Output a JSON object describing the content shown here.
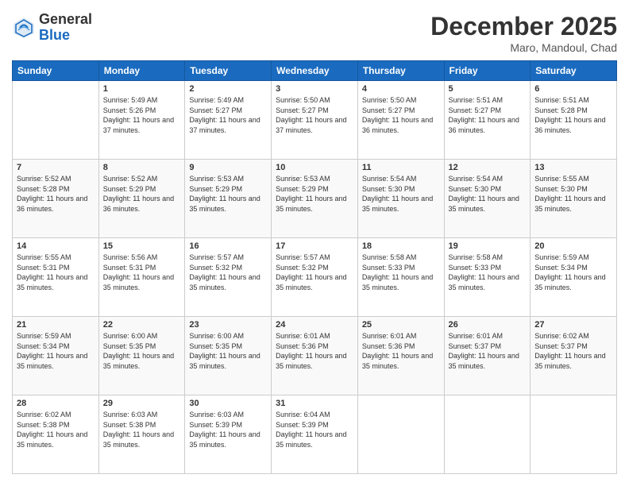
{
  "header": {
    "logo_general": "General",
    "logo_blue": "Blue",
    "title": "December 2025",
    "location": "Maro, Mandoul, Chad"
  },
  "weekdays": [
    "Sunday",
    "Monday",
    "Tuesday",
    "Wednesday",
    "Thursday",
    "Friday",
    "Saturday"
  ],
  "weeks": [
    [
      {
        "day": "",
        "sunrise": "",
        "sunset": "",
        "daylight": ""
      },
      {
        "day": "1",
        "sunrise": "Sunrise: 5:49 AM",
        "sunset": "Sunset: 5:26 PM",
        "daylight": "Daylight: 11 hours and 37 minutes."
      },
      {
        "day": "2",
        "sunrise": "Sunrise: 5:49 AM",
        "sunset": "Sunset: 5:27 PM",
        "daylight": "Daylight: 11 hours and 37 minutes."
      },
      {
        "day": "3",
        "sunrise": "Sunrise: 5:50 AM",
        "sunset": "Sunset: 5:27 PM",
        "daylight": "Daylight: 11 hours and 37 minutes."
      },
      {
        "day": "4",
        "sunrise": "Sunrise: 5:50 AM",
        "sunset": "Sunset: 5:27 PM",
        "daylight": "Daylight: 11 hours and 36 minutes."
      },
      {
        "day": "5",
        "sunrise": "Sunrise: 5:51 AM",
        "sunset": "Sunset: 5:27 PM",
        "daylight": "Daylight: 11 hours and 36 minutes."
      },
      {
        "day": "6",
        "sunrise": "Sunrise: 5:51 AM",
        "sunset": "Sunset: 5:28 PM",
        "daylight": "Daylight: 11 hours and 36 minutes."
      }
    ],
    [
      {
        "day": "7",
        "sunrise": "Sunrise: 5:52 AM",
        "sunset": "Sunset: 5:28 PM",
        "daylight": "Daylight: 11 hours and 36 minutes."
      },
      {
        "day": "8",
        "sunrise": "Sunrise: 5:52 AM",
        "sunset": "Sunset: 5:29 PM",
        "daylight": "Daylight: 11 hours and 36 minutes."
      },
      {
        "day": "9",
        "sunrise": "Sunrise: 5:53 AM",
        "sunset": "Sunset: 5:29 PM",
        "daylight": "Daylight: 11 hours and 35 minutes."
      },
      {
        "day": "10",
        "sunrise": "Sunrise: 5:53 AM",
        "sunset": "Sunset: 5:29 PM",
        "daylight": "Daylight: 11 hours and 35 minutes."
      },
      {
        "day": "11",
        "sunrise": "Sunrise: 5:54 AM",
        "sunset": "Sunset: 5:30 PM",
        "daylight": "Daylight: 11 hours and 35 minutes."
      },
      {
        "day": "12",
        "sunrise": "Sunrise: 5:54 AM",
        "sunset": "Sunset: 5:30 PM",
        "daylight": "Daylight: 11 hours and 35 minutes."
      },
      {
        "day": "13",
        "sunrise": "Sunrise: 5:55 AM",
        "sunset": "Sunset: 5:30 PM",
        "daylight": "Daylight: 11 hours and 35 minutes."
      }
    ],
    [
      {
        "day": "14",
        "sunrise": "Sunrise: 5:55 AM",
        "sunset": "Sunset: 5:31 PM",
        "daylight": "Daylight: 11 hours and 35 minutes."
      },
      {
        "day": "15",
        "sunrise": "Sunrise: 5:56 AM",
        "sunset": "Sunset: 5:31 PM",
        "daylight": "Daylight: 11 hours and 35 minutes."
      },
      {
        "day": "16",
        "sunrise": "Sunrise: 5:57 AM",
        "sunset": "Sunset: 5:32 PM",
        "daylight": "Daylight: 11 hours and 35 minutes."
      },
      {
        "day": "17",
        "sunrise": "Sunrise: 5:57 AM",
        "sunset": "Sunset: 5:32 PM",
        "daylight": "Daylight: 11 hours and 35 minutes."
      },
      {
        "day": "18",
        "sunrise": "Sunrise: 5:58 AM",
        "sunset": "Sunset: 5:33 PM",
        "daylight": "Daylight: 11 hours and 35 minutes."
      },
      {
        "day": "19",
        "sunrise": "Sunrise: 5:58 AM",
        "sunset": "Sunset: 5:33 PM",
        "daylight": "Daylight: 11 hours and 35 minutes."
      },
      {
        "day": "20",
        "sunrise": "Sunrise: 5:59 AM",
        "sunset": "Sunset: 5:34 PM",
        "daylight": "Daylight: 11 hours and 35 minutes."
      }
    ],
    [
      {
        "day": "21",
        "sunrise": "Sunrise: 5:59 AM",
        "sunset": "Sunset: 5:34 PM",
        "daylight": "Daylight: 11 hours and 35 minutes."
      },
      {
        "day": "22",
        "sunrise": "Sunrise: 6:00 AM",
        "sunset": "Sunset: 5:35 PM",
        "daylight": "Daylight: 11 hours and 35 minutes."
      },
      {
        "day": "23",
        "sunrise": "Sunrise: 6:00 AM",
        "sunset": "Sunset: 5:35 PM",
        "daylight": "Daylight: 11 hours and 35 minutes."
      },
      {
        "day": "24",
        "sunrise": "Sunrise: 6:01 AM",
        "sunset": "Sunset: 5:36 PM",
        "daylight": "Daylight: 11 hours and 35 minutes."
      },
      {
        "day": "25",
        "sunrise": "Sunrise: 6:01 AM",
        "sunset": "Sunset: 5:36 PM",
        "daylight": "Daylight: 11 hours and 35 minutes."
      },
      {
        "day": "26",
        "sunrise": "Sunrise: 6:01 AM",
        "sunset": "Sunset: 5:37 PM",
        "daylight": "Daylight: 11 hours and 35 minutes."
      },
      {
        "day": "27",
        "sunrise": "Sunrise: 6:02 AM",
        "sunset": "Sunset: 5:37 PM",
        "daylight": "Daylight: 11 hours and 35 minutes."
      }
    ],
    [
      {
        "day": "28",
        "sunrise": "Sunrise: 6:02 AM",
        "sunset": "Sunset: 5:38 PM",
        "daylight": "Daylight: 11 hours and 35 minutes."
      },
      {
        "day": "29",
        "sunrise": "Sunrise: 6:03 AM",
        "sunset": "Sunset: 5:38 PM",
        "daylight": "Daylight: 11 hours and 35 minutes."
      },
      {
        "day": "30",
        "sunrise": "Sunrise: 6:03 AM",
        "sunset": "Sunset: 5:39 PM",
        "daylight": "Daylight: 11 hours and 35 minutes."
      },
      {
        "day": "31",
        "sunrise": "Sunrise: 6:04 AM",
        "sunset": "Sunset: 5:39 PM",
        "daylight": "Daylight: 11 hours and 35 minutes."
      },
      {
        "day": "",
        "sunrise": "",
        "sunset": "",
        "daylight": ""
      },
      {
        "day": "",
        "sunrise": "",
        "sunset": "",
        "daylight": ""
      },
      {
        "day": "",
        "sunrise": "",
        "sunset": "",
        "daylight": ""
      }
    ]
  ]
}
